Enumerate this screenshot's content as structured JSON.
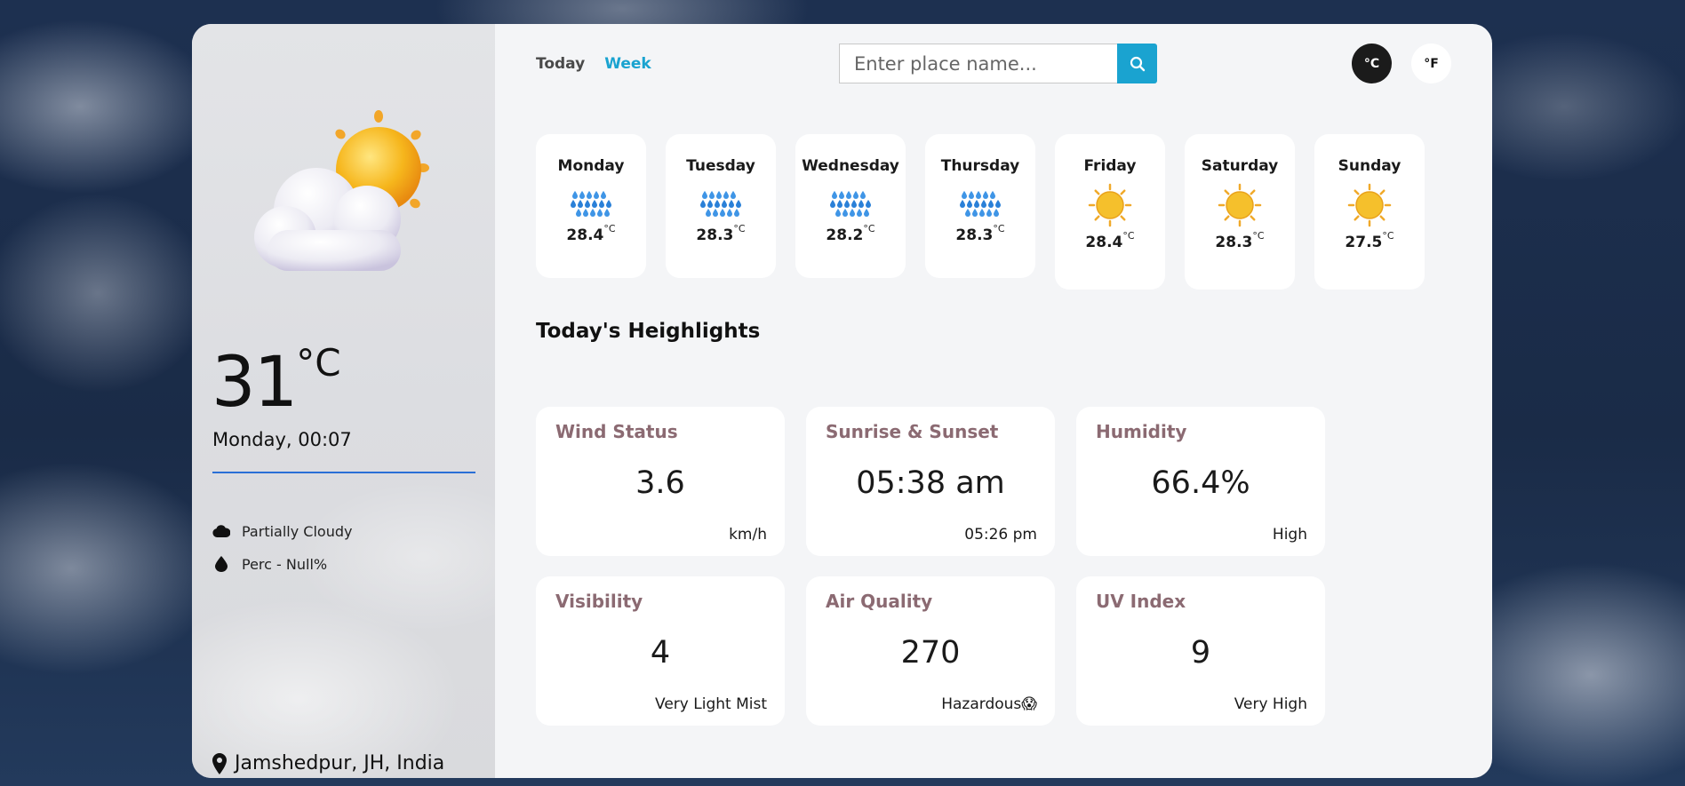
{
  "tabs": {
    "today": "Today",
    "week": "Week"
  },
  "search": {
    "placeholder": "Enter place name..."
  },
  "units": {
    "celsius": "°C",
    "fahrenheit": "°F"
  },
  "current": {
    "temp": "31",
    "temp_unit": "°C",
    "datetime": "Monday, 00:07",
    "condition": "Partially Cloudy",
    "precip": "Perc - Null%",
    "location": "Jamshedpur, JH, India",
    "icon": "partly-cloudy-icon"
  },
  "week": [
    {
      "day": "Monday",
      "temp": "28.4",
      "unit": "°C",
      "icon": "rain-icon"
    },
    {
      "day": "Tuesday",
      "temp": "28.3",
      "unit": "°C",
      "icon": "rain-icon"
    },
    {
      "day": "Wednesday",
      "temp": "28.2",
      "unit": "°C",
      "icon": "rain-icon"
    },
    {
      "day": "Thursday",
      "temp": "28.3",
      "unit": "°C",
      "icon": "rain-icon"
    },
    {
      "day": "Friday",
      "temp": "28.4",
      "unit": "°C",
      "icon": "sun-icon"
    },
    {
      "day": "Saturday",
      "temp": "28.3",
      "unit": "°C",
      "icon": "sun-icon"
    },
    {
      "day": "Sunday",
      "temp": "27.5",
      "unit": "°C",
      "icon": "sun-icon"
    }
  ],
  "highlights": {
    "title": "Today's Heighlights",
    "wind": {
      "title": "Wind Status",
      "value": "3.6",
      "sub": "km/h"
    },
    "sun": {
      "title": "Sunrise & Sunset",
      "value": "05:38 am",
      "sub": "05:26 pm"
    },
    "humidity": {
      "title": "Humidity",
      "value": "66.4%",
      "sub": "High"
    },
    "visibility": {
      "title": "Visibility",
      "value": "4",
      "sub": "Very Light Mist"
    },
    "air": {
      "title": "Air Quality",
      "value": "270",
      "sub": "Hazardous😱"
    },
    "uv": {
      "title": "UV Index",
      "value": "9",
      "sub": "Very High"
    }
  },
  "colors": {
    "accent": "#1aa3d0",
    "divider": "#2a6fd6",
    "card_title": "#8b6a72"
  }
}
